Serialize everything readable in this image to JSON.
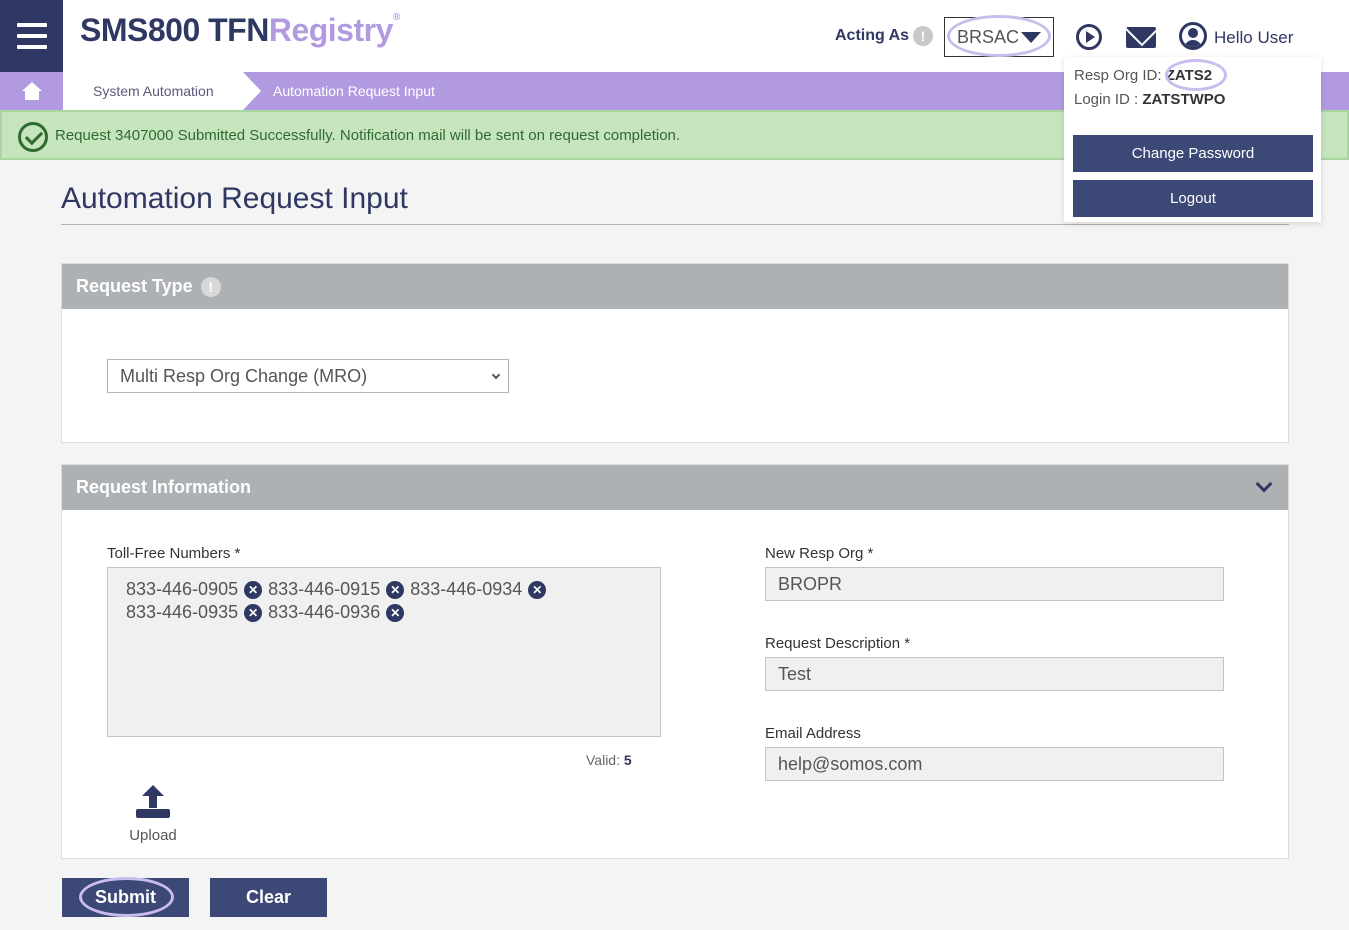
{
  "header": {
    "logo_primary": "SMS800 TFN",
    "logo_secondary": "Registry",
    "logo_mark": "®",
    "acting_as_label": "Acting As",
    "acting_as_info": "!",
    "acting_as_value": "BRSAC",
    "greeting": "Hello User"
  },
  "breadcrumb": {
    "parent": "System Automation",
    "current": "Automation Request Input"
  },
  "alert": {
    "message": "Request 3407000 Submitted Successfully. Notification mail will be sent on request completion."
  },
  "user_menu": {
    "resp_org_label": "Resp Org ID:",
    "resp_org_value": "ZATS2",
    "login_label": "Login ID :",
    "login_value": "ZATSTWPO",
    "change_password": "Change Password",
    "logout": "Logout"
  },
  "page_title": "Automation Request Input",
  "request_type": {
    "heading": "Request Type",
    "info": "!",
    "selected": "Multi Resp Org Change (MRO)"
  },
  "request_info": {
    "heading": "Request Information",
    "tfn_label": "Toll-Free Numbers *",
    "numbers": [
      "833-446-0905",
      "833-446-0915",
      "833-446-0934",
      "833-446-0935",
      "833-446-0936"
    ],
    "remove_glyph": "✕",
    "valid_label": "Valid:",
    "valid_count": "5",
    "upload_label": "Upload",
    "new_resp_org_label": "New Resp Org *",
    "new_resp_org_value": "BROPR",
    "description_label": "Request Description *",
    "description_value": "Test",
    "email_label": "Email Address",
    "email_value": "help@somos.com"
  },
  "actions": {
    "submit": "Submit",
    "clear": "Clear"
  },
  "colors": {
    "navy": "#2f3863",
    "lavender": "#b19ae0",
    "success_bg": "#c6e5bf",
    "panel_header": "#aeb1b4"
  }
}
